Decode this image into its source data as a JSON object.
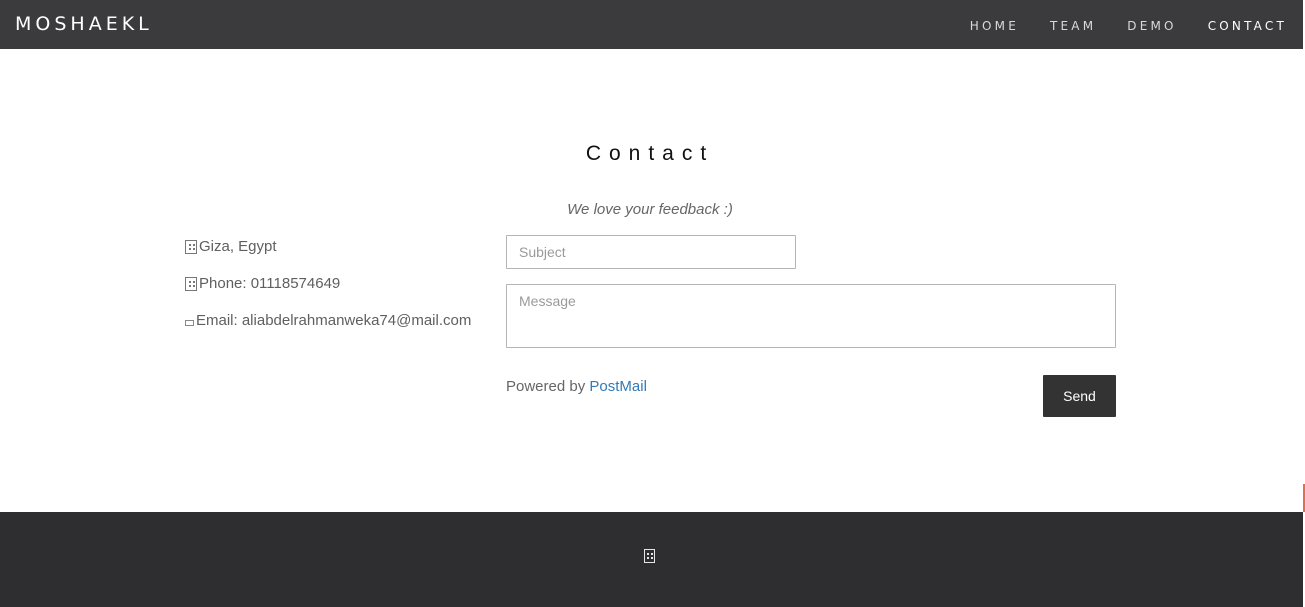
{
  "header": {
    "brand": "MOSHAEKL",
    "nav": [
      {
        "label": "HOME",
        "active": false
      },
      {
        "label": "TEAM",
        "active": false
      },
      {
        "label": "DEMO",
        "active": false
      },
      {
        "label": "CONTACT",
        "active": true
      }
    ]
  },
  "contact": {
    "title": "Contact",
    "tagline": "We love your feedback :)",
    "info": {
      "address": "Giza, Egypt",
      "phone": "Phone: 01118574649",
      "email": "Email: aliabdelrahmanweka74@mail.com"
    },
    "form": {
      "subject_placeholder": "Subject",
      "subject_value": "",
      "message_placeholder": "Message",
      "message_value": "",
      "powered_prefix": "Powered by",
      "powered_link": "PostMail",
      "send_label": "Send"
    }
  },
  "footer": {
    "icon": "building-icon"
  },
  "colors": {
    "navbar": "#3b3b3d",
    "footer": "#2e2e30",
    "button": "#333333",
    "link": "#337ab7"
  }
}
